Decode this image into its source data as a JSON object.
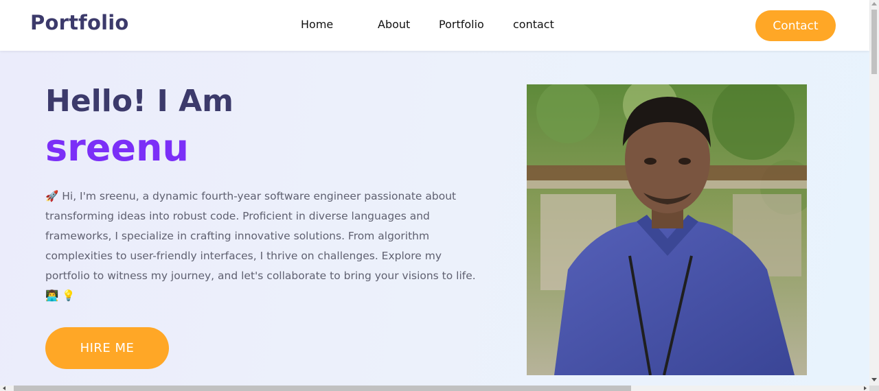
{
  "navbar": {
    "logo": "Portfolio",
    "links": [
      "Home",
      "About",
      "Portfolio",
      "contact"
    ],
    "cta_label": "Contact"
  },
  "hero": {
    "greeting": "Hello! I Am",
    "name": "sreenu",
    "bio": "🚀 Hi, I'm sreenu, a dynamic fourth-year software engineer passionate about transforming ideas into robust code. Proficient in diverse languages and frameworks, I specialize in crafting innovative solutions. From algorithm complexities to user-friendly interfaces, I thrive on challenges. Explore my portfolio to witness my journey, and let's collaborate to bring your visions to life. 👨‍💻 💡",
    "hire_label": "HIRE ME",
    "photo_icon": "profile-photo"
  },
  "colors": {
    "brand": "#3c3a6b",
    "accent": "#7b2ff7",
    "cta": "#ffa726",
    "text": "#5f6070"
  }
}
